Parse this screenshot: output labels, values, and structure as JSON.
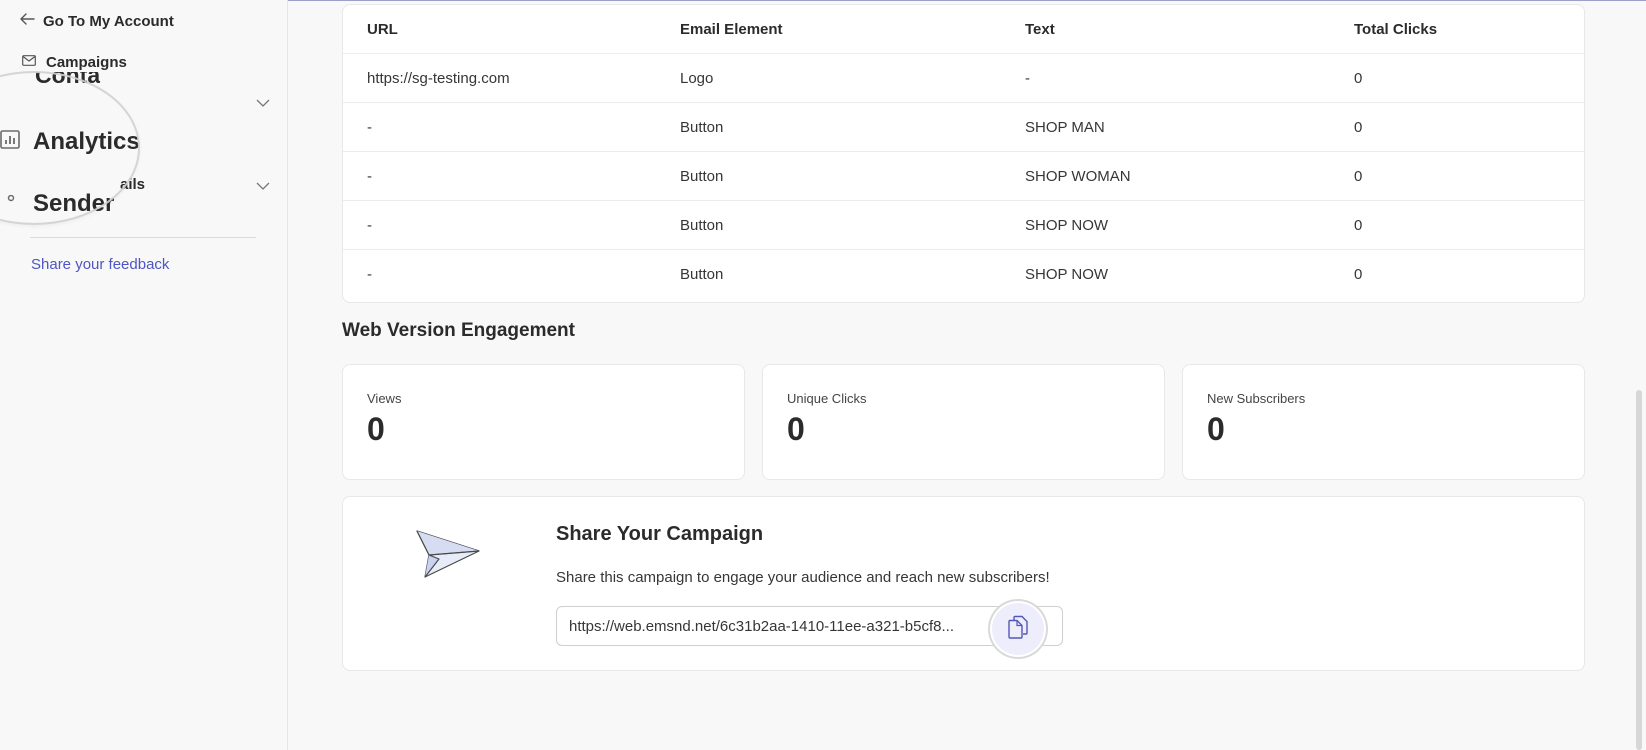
{
  "sidebar": {
    "back_label": "Go To My Account",
    "campaigns_label": "Campaigns",
    "magnifier": {
      "contacts_partial": "Conta",
      "analytics_label": "Analytics",
      "sender_partial": "Sender"
    },
    "sender_emails_partial": "ails",
    "feedback_label": "Share your feedback"
  },
  "links_table": {
    "columns": [
      "URL",
      "Email Element",
      "Text",
      "Total Clicks"
    ],
    "rows": [
      [
        "https://sg-testing.com",
        "Logo",
        "-",
        "0"
      ],
      [
        "-",
        "Button",
        "SHOP MAN",
        "0"
      ],
      [
        "-",
        "Button",
        "SHOP WOMAN",
        "0"
      ],
      [
        "-",
        "Button",
        "SHOP NOW",
        "0"
      ],
      [
        "-",
        "Button",
        "SHOP NOW",
        "0"
      ]
    ]
  },
  "web_engagement": {
    "title": "Web Version Engagement",
    "stats": [
      {
        "label": "Views",
        "value": "0"
      },
      {
        "label": "Unique Clicks",
        "value": "0"
      },
      {
        "label": "New Subscribers",
        "value": "0"
      }
    ]
  },
  "share": {
    "icon": "paper-plane-icon",
    "title": "Share Your Campaign",
    "description": "Share this campaign to engage your audience and reach new subscribers!",
    "url": "https://web.emsnd.net/6c31b2aa-1410-11ee-a321-b5cf8...",
    "copy_icon": "copy-icon"
  },
  "colors": {
    "accent": "#4f55c2",
    "background": "#f8f8f8",
    "card": "#ffffff"
  }
}
